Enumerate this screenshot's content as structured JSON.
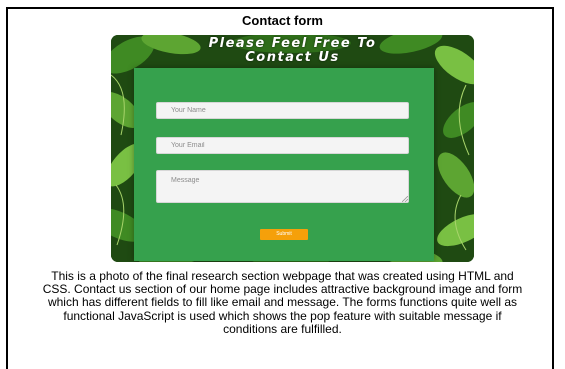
{
  "page": {
    "title": "Contact form",
    "description": "This is a photo of the final research section webpage that was created using HTML and CSS. Contact us section of our home page includes attractive background image and form which has different fields to fill like email and message. The forms functions quite well as functional JavaScript is used which shows the pop feature with suitable message if conditions are fulfilled."
  },
  "hero": {
    "heading_line1": "Please Feel Free To",
    "heading_line2": "Contact Us"
  },
  "form": {
    "name_placeholder": "Your Name",
    "email_placeholder": "Your Email",
    "message_placeholder": "Message",
    "submit_label": "Submit"
  },
  "colors": {
    "panel_green": "#36a14d",
    "submit_orange": "#f5a00a",
    "leaf_dark": "#1f4a12",
    "leaf_mid": "#3f8a23",
    "leaf_light": "#79c043"
  }
}
